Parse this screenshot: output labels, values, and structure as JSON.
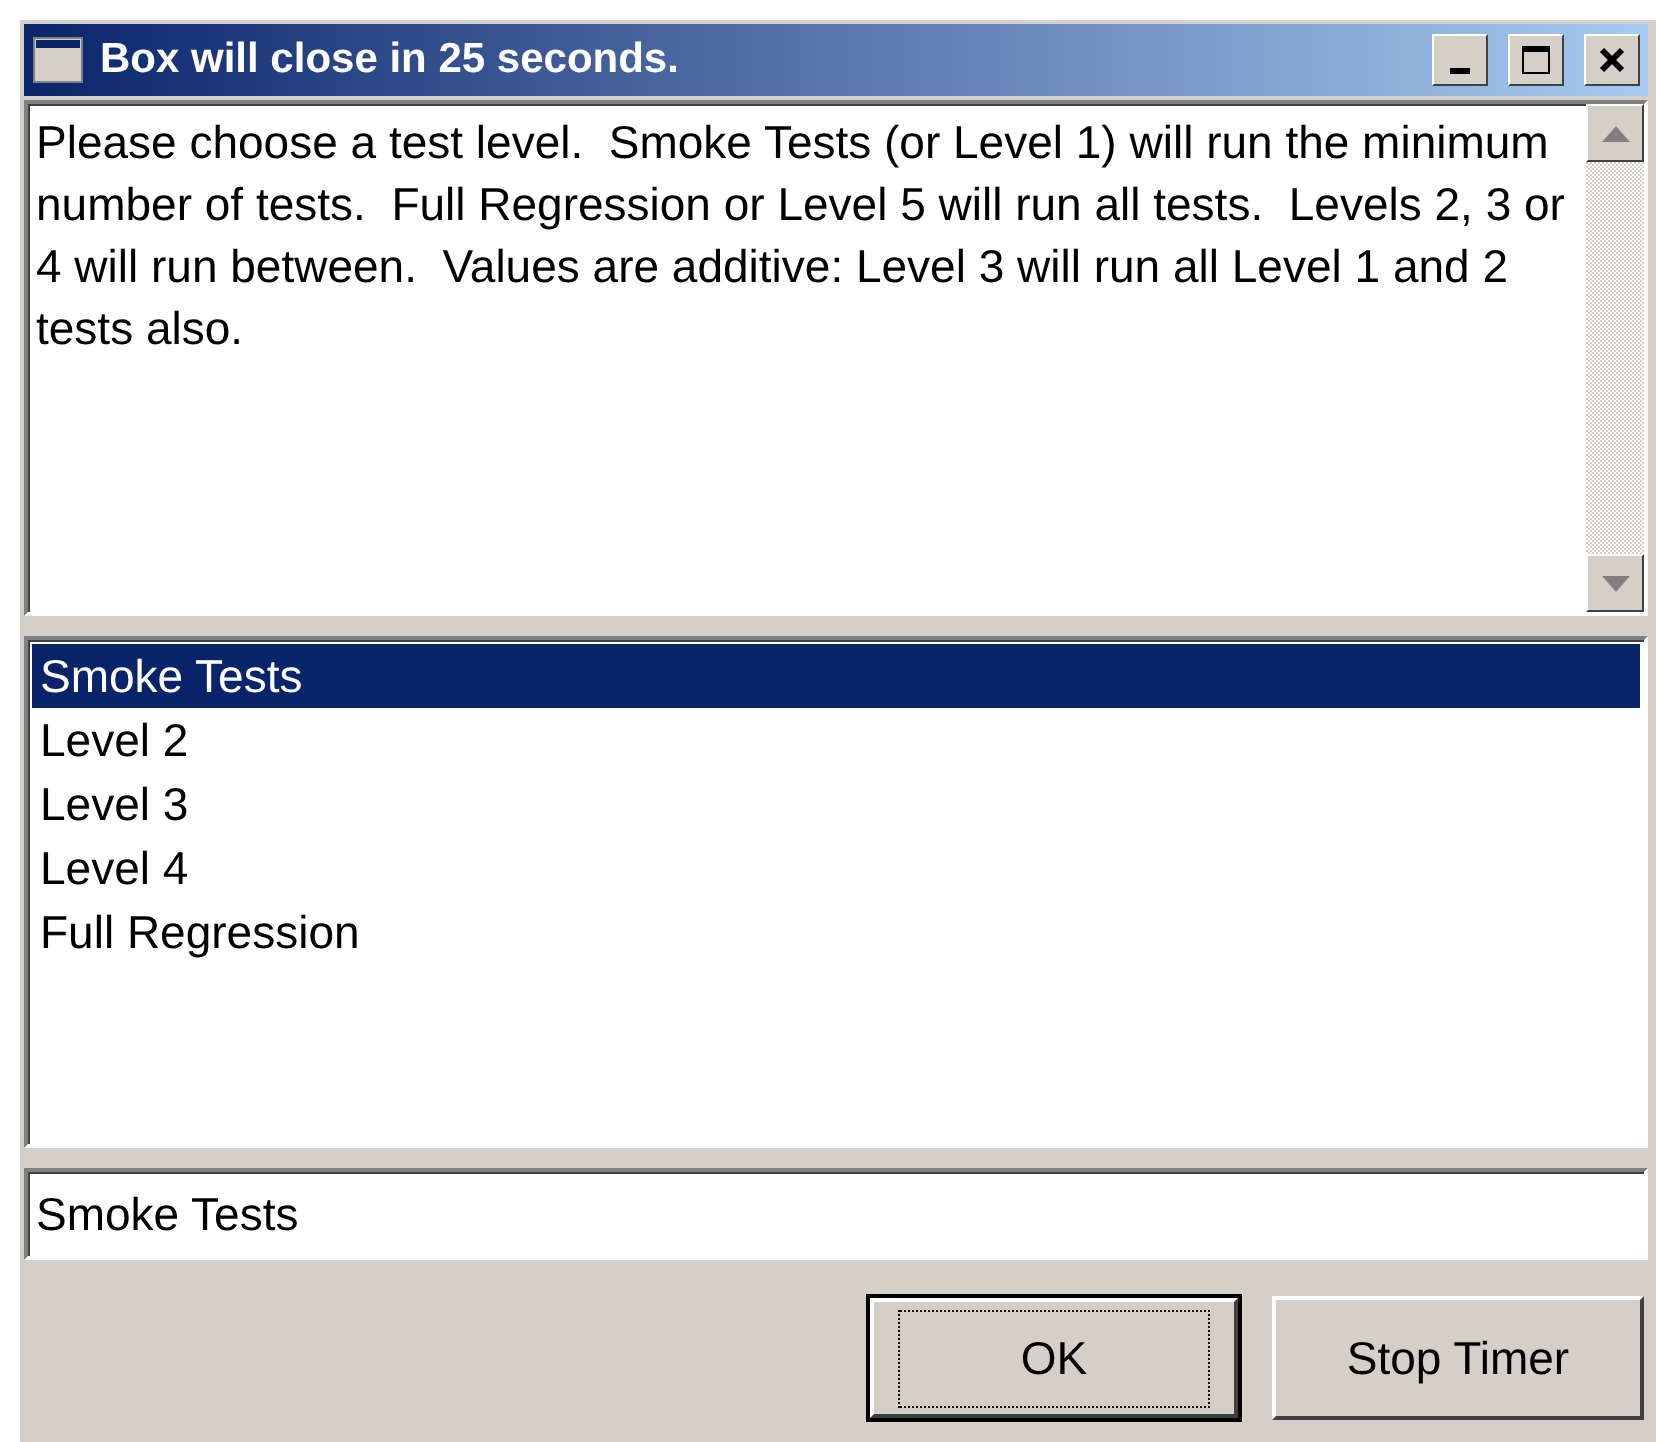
{
  "window": {
    "title": "Box will close in 25 seconds."
  },
  "message": {
    "text": "Please choose a test level.  Smoke Tests (or Level 1) will run the minimum number of tests.  Full Regression or Level 5 will run all tests.  Levels 2, 3 or 4 will run between.  Values are additive: Level 3 will run all Level 1 and 2 tests also."
  },
  "levels": [
    {
      "label": "Smoke Tests",
      "selected": true
    },
    {
      "label": "Level 2",
      "selected": false
    },
    {
      "label": "Level 3",
      "selected": false
    },
    {
      "label": "Level 4",
      "selected": false
    },
    {
      "label": "Full Regression",
      "selected": false
    }
  ],
  "selection_field": {
    "value": "Smoke Tests"
  },
  "buttons": [
    {
      "label": "OK",
      "default": true
    },
    {
      "label": "Stop Timer",
      "default": false
    }
  ]
}
